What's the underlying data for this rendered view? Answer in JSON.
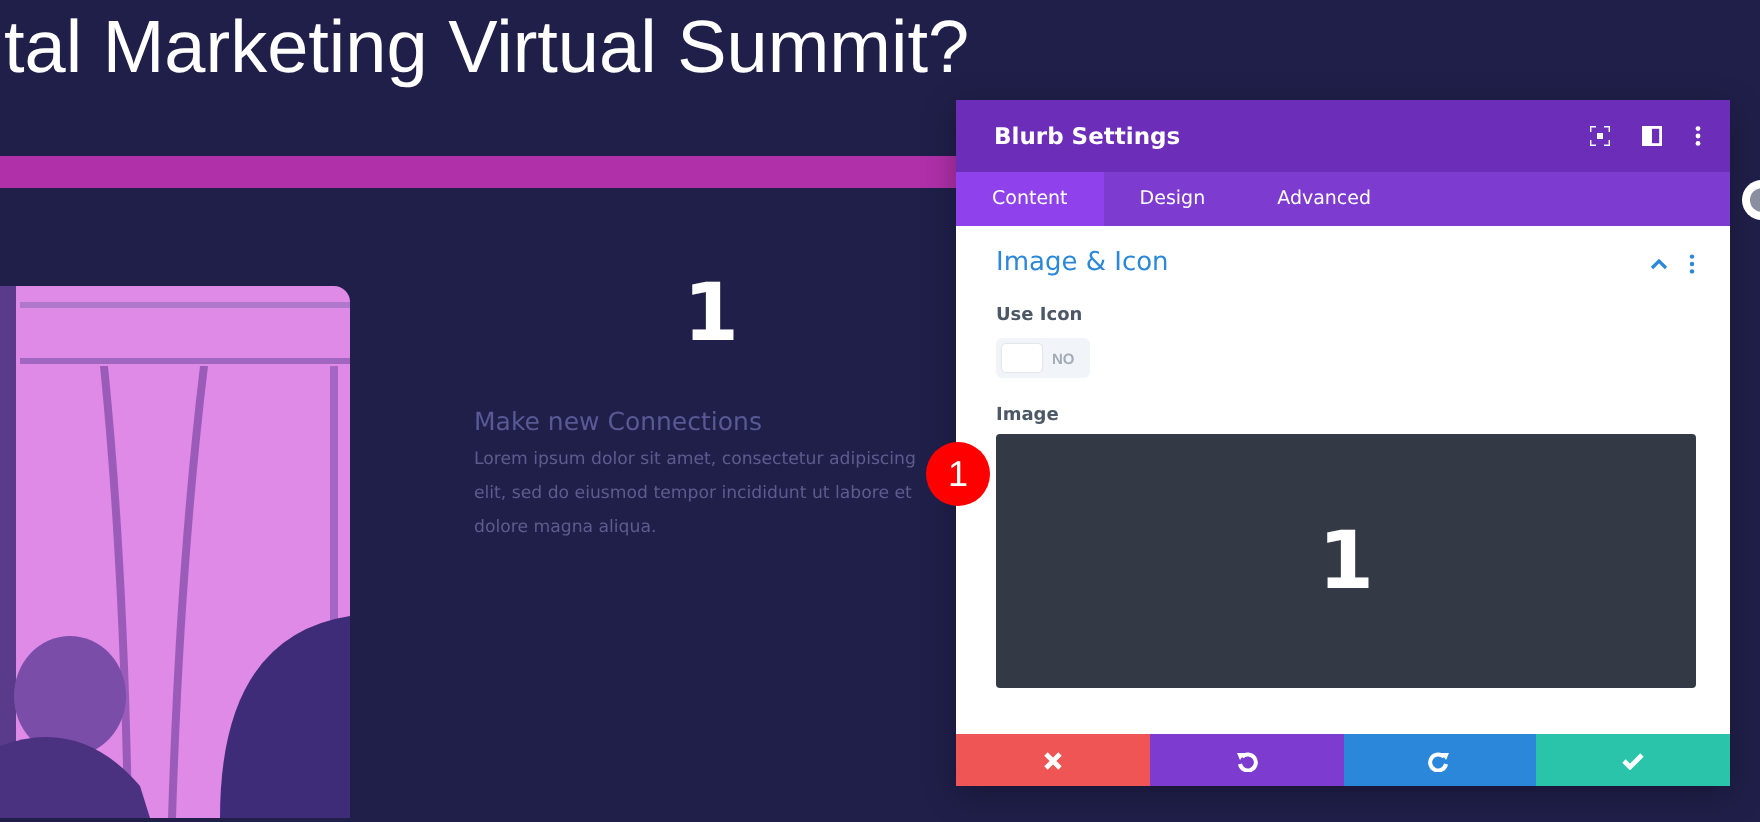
{
  "page": {
    "heading": "tal Marketing Virtual Summit?",
    "blurb": {
      "number": "1",
      "title": "Make new Connections",
      "body": "Lorem ipsum dolor sit amet, consectetur adipiscing elit, sed do eiusmod tempor incididunt ut labore et dolore magna aliqua."
    }
  },
  "panel": {
    "title": "Blurb Settings",
    "tabs": [
      {
        "label": "Content",
        "selected": true
      },
      {
        "label": "Design",
        "selected": false
      },
      {
        "label": "Advanced",
        "selected": false
      }
    ],
    "section": {
      "title": "Image & Icon",
      "expanded": true
    },
    "use_icon": {
      "label": "Use Icon",
      "on": false,
      "state_text": "NO"
    },
    "image": {
      "label": "Image",
      "preview": "1"
    },
    "actions": [
      {
        "kind": "cancel"
      },
      {
        "kind": "undo"
      },
      {
        "kind": "redo"
      },
      {
        "kind": "save"
      }
    ]
  },
  "badge": "1"
}
